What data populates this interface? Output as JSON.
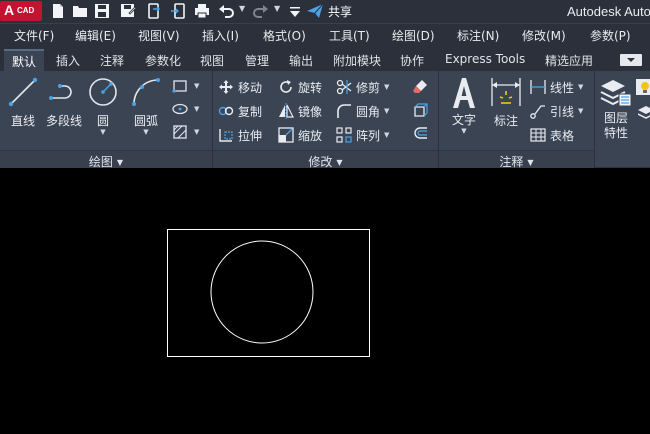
{
  "title_bar": {
    "logo_text": "A",
    "logo_sub": "CAD",
    "share_label": "共享",
    "app_title": "Autodesk Auto",
    "quick_access_icons": [
      "new-file-icon",
      "open-folder-icon",
      "save-icon",
      "save-as-icon",
      "open-from-mobile-icon",
      "save-to-mobile-icon",
      "plot-icon",
      "undo-icon",
      "redo-icon",
      "customize-caret-icon",
      "share-icon"
    ]
  },
  "menubar": {
    "items": [
      "文件(F)",
      "编辑(E)",
      "视图(V)",
      "插入(I)",
      "格式(O)",
      "工具(T)",
      "绘图(D)",
      "标注(N)",
      "修改(M)",
      "参数(P)"
    ]
  },
  "ribbon_tabs": {
    "items": [
      "默认",
      "插入",
      "注释",
      "参数化",
      "视图",
      "管理",
      "输出",
      "附加模块",
      "协作",
      "Express Tools",
      "精选应用"
    ],
    "active": "默认"
  },
  "panels": {
    "draw": {
      "title": "绘图",
      "tools": {
        "line": "直线",
        "polyline": "多段线",
        "circle": "圆",
        "arc": "圆弧"
      }
    },
    "modify": {
      "title": "修改",
      "tools": {
        "move": "移动",
        "rotate": "旋转",
        "trim": "修剪",
        "copy": "复制",
        "mirror": "镜像",
        "fillet": "圆角",
        "stretch": "拉伸",
        "scale": "缩放",
        "array": "阵列"
      }
    },
    "annotation": {
      "title": "注释",
      "tools": {
        "text": "文字",
        "dimension": "标注",
        "linear": "线性",
        "leader": "引线",
        "table": "表格"
      }
    },
    "layers": {
      "tools": {
        "layer_properties_line1": "图层",
        "layer_properties_line2": "特性"
      }
    }
  },
  "colors": {
    "titlebar_bg": "#2b303b",
    "ribbon_bg": "#3b4453",
    "canvas_bg": "#000000",
    "accent_blue": "#4aa3e8",
    "logo_red": "#c41231",
    "drawing_stroke": "#ffffff"
  },
  "canvas": {
    "objects": [
      "rectangle",
      "circle"
    ]
  }
}
